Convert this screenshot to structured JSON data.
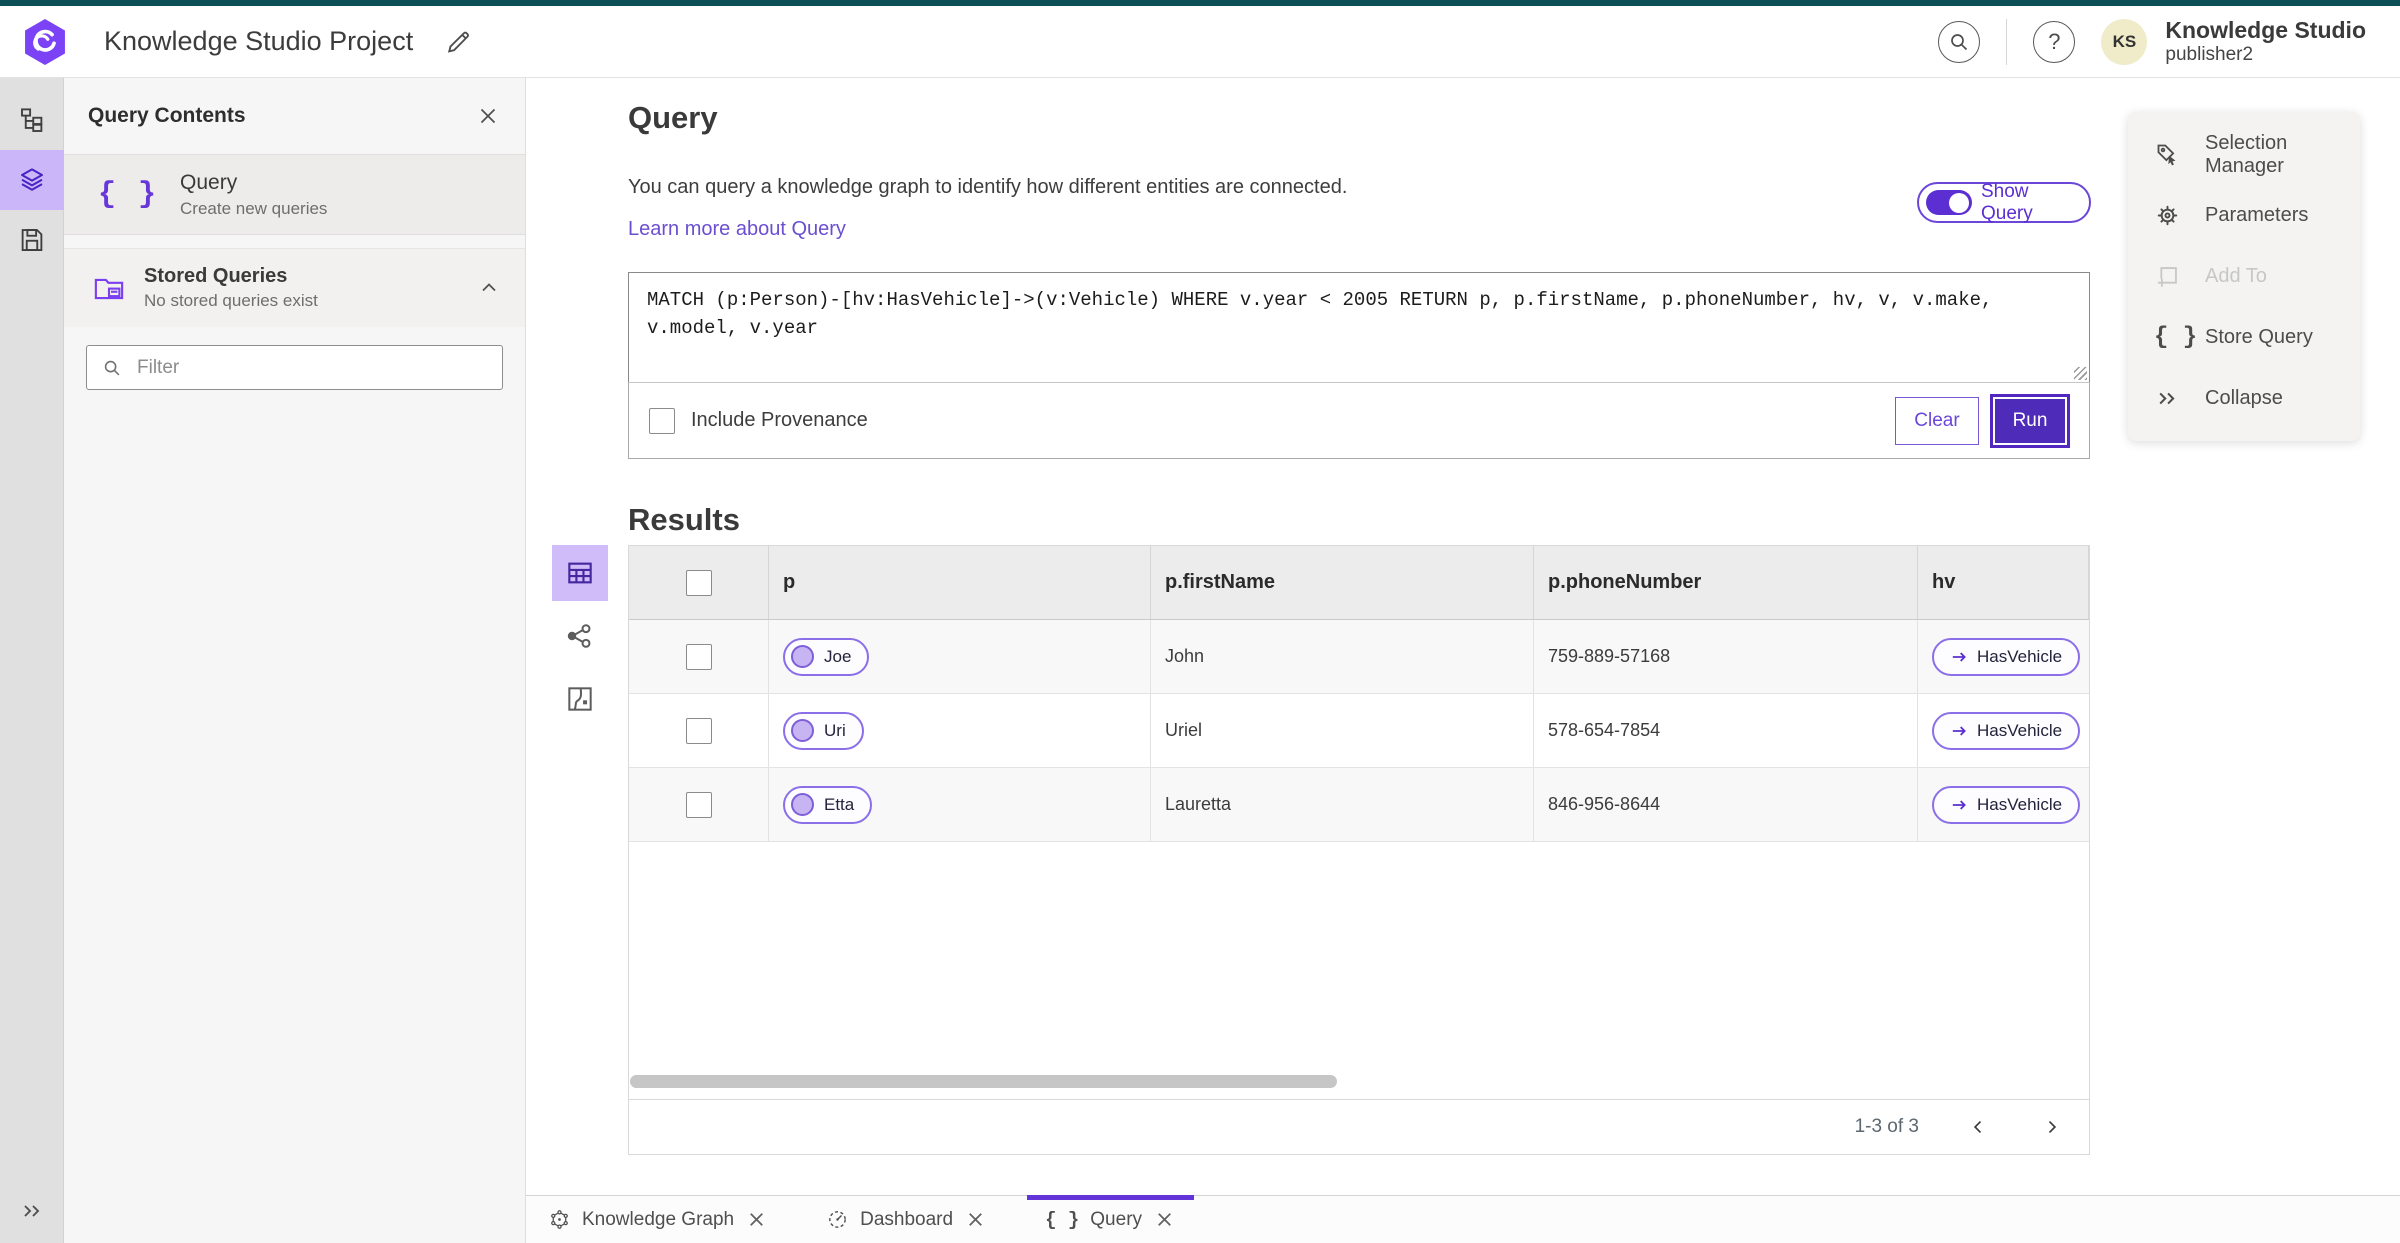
{
  "colors": {
    "accent": "#5b2fd1",
    "accent_light": "#cbb6f9",
    "run_fill": "#4f2bba",
    "link": "#6a4fd0",
    "top_strip": "#0c4f57",
    "avatar_bg": "#f0ecc9"
  },
  "header": {
    "app_title": "Knowledge Studio Project",
    "user_name": "Knowledge Studio",
    "user_role": "publisher2",
    "avatar_initials": "KS"
  },
  "left_panel": {
    "title": "Query Contents",
    "query_item": {
      "label": "Query",
      "description": "Create new queries"
    },
    "stored_queries": {
      "label": "Stored Queries",
      "description": "No stored queries exist"
    },
    "filter_placeholder": "Filter"
  },
  "query_section": {
    "heading": "Query",
    "description": "You can query a knowledge graph to identify how different entities are connected.",
    "learn_more": "Learn more about Query",
    "show_query_label": "Show Query",
    "show_query_on": true,
    "query_text": "MATCH (p:Person)-[hv:HasVehicle]->(v:Vehicle) WHERE v.year < 2005 RETURN p, p.firstName, p.phoneNumber, hv, v, v.make, v.model, v.year",
    "include_provenance_label": "Include Provenance",
    "include_provenance_checked": false,
    "clear_label": "Clear",
    "run_label": "Run"
  },
  "results": {
    "heading": "Results",
    "columns": [
      "p",
      "p.firstName",
      "p.phoneNumber",
      "hv"
    ],
    "rows": [
      {
        "p": "Joe",
        "firstName": "John",
        "phoneNumber": "759-889-57168",
        "hv": "HasVehicle"
      },
      {
        "p": "Uri",
        "firstName": "Uriel",
        "phoneNumber": "578-654-7854",
        "hv": "HasVehicle"
      },
      {
        "p": "Etta",
        "firstName": "Lauretta",
        "phoneNumber": "846-956-8644",
        "hv": "HasVehicle"
      }
    ],
    "pagination": "1-3 of 3"
  },
  "right_menu": {
    "items": [
      {
        "label": "Selection Manager",
        "disabled": false
      },
      {
        "label": "Parameters",
        "disabled": false
      },
      {
        "label": "Add To",
        "disabled": true
      },
      {
        "label": "Store Query",
        "disabled": false
      },
      {
        "label": "Collapse",
        "disabled": false
      }
    ]
  },
  "bottom_tabs": [
    {
      "label": "Knowledge Graph",
      "active": false
    },
    {
      "label": "Dashboard",
      "active": false
    },
    {
      "label": "Query",
      "active": true
    }
  ]
}
